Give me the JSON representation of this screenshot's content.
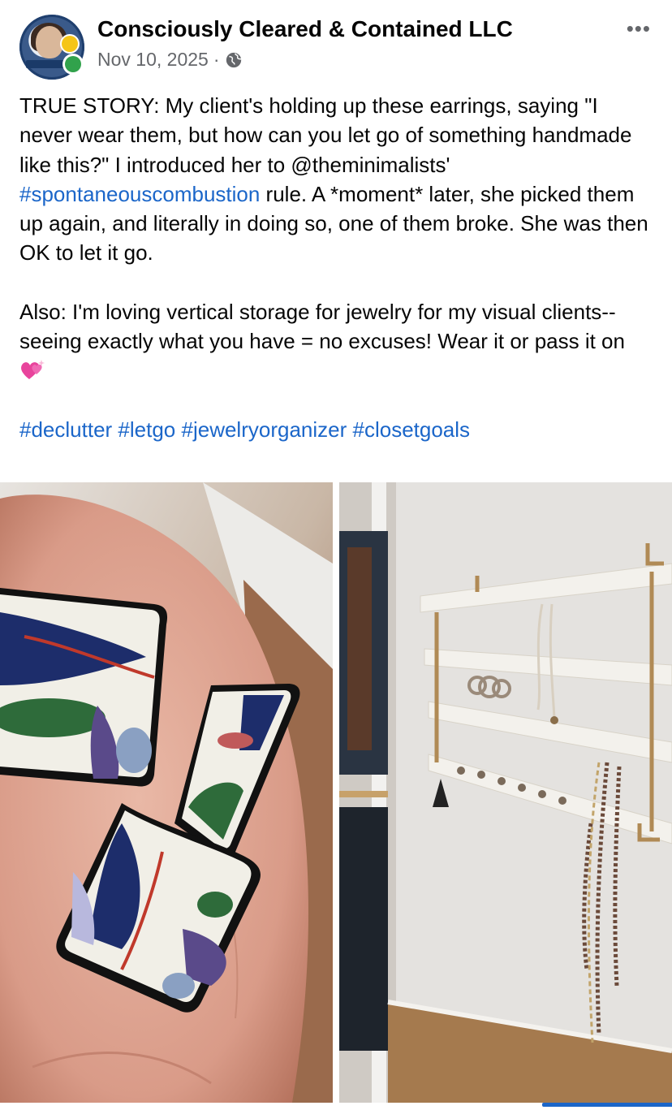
{
  "post": {
    "author": "Consciously Cleared & Contained LLC",
    "date": "Nov 10, 2025",
    "separator": "·",
    "privacy_icon": "globe-icon",
    "more_label": "•••",
    "text_para1_before_link": "TRUE STORY: My client's holding up these earrings, saying \"I never wear them, but how can you let go of something handmade like this?\" I introduced her to @theminimalists' ",
    "text_para1_link": "#spontaneouscombustion",
    "text_para1_after_link": " rule. A *moment* later, she picked them up again, and literally in doing so, one of them broke. She was then OK to let it go.",
    "text_para2": "Also: I'm loving vertical storage for jewelry for my visual clients--seeing exactly what you have = no excuses! Wear it or pass it on ",
    "emoji": "sparkling-hearts-emoji",
    "hashtags": [
      "#declutter",
      "#letgo",
      "#jewelryorganizer",
      "#closetgoals"
    ]
  },
  "photos": [
    {
      "name": "broken-earrings-photo"
    },
    {
      "name": "jewelry-organizer-photo"
    }
  ],
  "colors": {
    "link": "#1b66c9",
    "meta": "#65676b",
    "online": "#31a24c"
  }
}
